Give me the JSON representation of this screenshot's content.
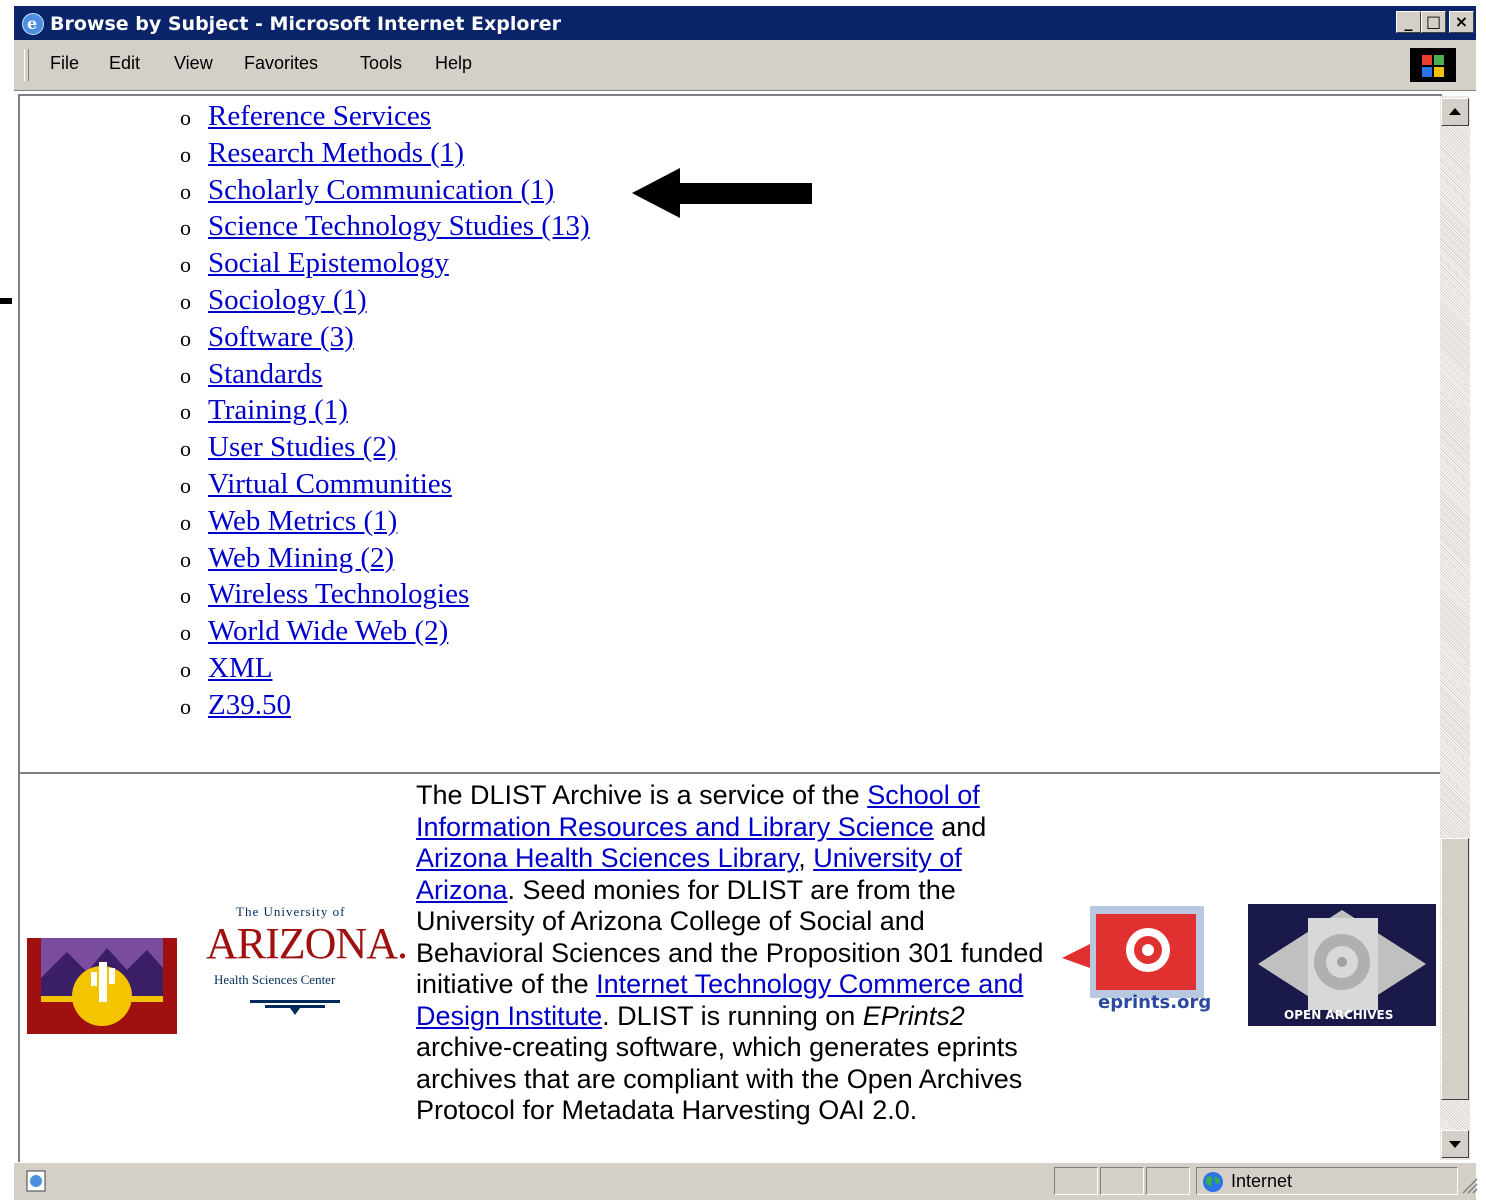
{
  "window": {
    "title": "Browse by Subject - Microsoft Internet Explorer",
    "controls": {
      "minimize": "_",
      "maximize": "□",
      "close": "×"
    }
  },
  "menubar": {
    "items": [
      "File",
      "Edit",
      "View",
      "Favorites",
      "Tools",
      "Help"
    ]
  },
  "subjects": [
    "Reference Services",
    "Research Methods (1)",
    "Scholarly Communication (1)",
    "Science Technology Studies (13)",
    "Social Epistemology",
    "Sociology (1)",
    "Software (3)",
    "Standards",
    "Training (1)",
    "User Studies (2)",
    "Virtual Communities",
    "Web Metrics (1)",
    "Web Mining (2)",
    "Wireless Technologies",
    "World Wide Web (2)",
    "XML",
    "Z39.50"
  ],
  "bullet": "o",
  "footer": {
    "t1": "The DLIST Archive is a service of the ",
    "link_sirls": "School of Information Resources and Library Science",
    "t2": " and ",
    "link_ahsl": "Arizona Health Sciences Library",
    "t3": ", ",
    "link_ua": "University of Arizona",
    "t4": ". Seed monies for DLIST are from the University of Arizona College of Social and Behavioral Sciences and the Proposition 301 funded initiative of the ",
    "link_itcdi": "Internet Technology Commerce and Design Institute",
    "t5": ". DLIST is running on ",
    "eprints2": "EPrints2",
    "t6": " archive-creating software, which generates eprints archives that are compliant with the Open Archives Protocol for Metadata Harvesting OAI 2.0."
  },
  "logos": {
    "ua_line1": "The University of",
    "ua_line2": "ARIZONA.",
    "ua_line3": "Health Sciences Center",
    "eprints": "eprints.org",
    "oa": "OPEN ARCHIVES"
  },
  "statusbar": {
    "zone": "Internet"
  },
  "colors": {
    "link": "#0000cc",
    "titlebar": "#0a246a",
    "chrome": "#d4d0c8"
  }
}
